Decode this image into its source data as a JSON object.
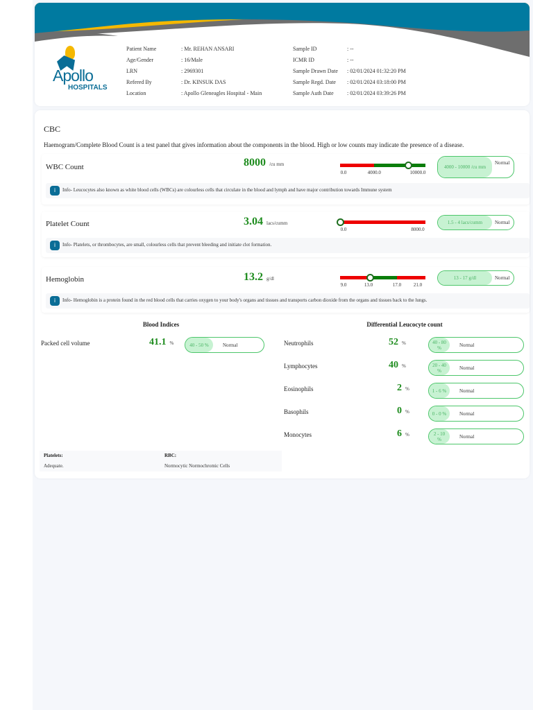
{
  "header": {
    "logo": {
      "line1": "Apollo",
      "line2": "HOSPITALS"
    },
    "left": [
      {
        "label": "Patient Name",
        "value": ": Mr. REHAN ANSARI"
      },
      {
        "label": "Age/Gender",
        "value": ": 16/Male"
      },
      {
        "label": "LRN",
        "value": ": 2969301"
      },
      {
        "label": "Refered By",
        "value": ": Dr. KINSUK DAS"
      },
      {
        "label": "Location",
        "value": ": Apollo Gleneagles Hospital - Main"
      }
    ],
    "right": [
      {
        "label": "Sample ID",
        "value": ": --"
      },
      {
        "label": "ICMR ID",
        "value": ": --"
      },
      {
        "label": "Sample Drawn Date",
        "value": ": 02/01/2024 01:32:20 PM"
      },
      {
        "label": "Sample Regd. Date",
        "value": ": 02/01/2024 03:18:00 PM"
      },
      {
        "label": "Sample Auth Date",
        "value": ": 02/01/2024 03:39:26 PM"
      }
    ]
  },
  "colors": {
    "teal": "#007aa0",
    "yellow": "#f5b800",
    "gray": "#6e6e6e",
    "green": "#1e8c1e",
    "red": "#ee0000",
    "bar_green": "#0a7d0a"
  },
  "cbc": {
    "title": "CBC",
    "description": "Haemogram/Complete Blood Count is a test panel that gives information about the components in the blood. High or low counts may indicate the presence of a disease.",
    "tests": [
      {
        "name": "WBC Count",
        "value": "8000",
        "unit": "/cu mm",
        "range": "4000 - 10000 /cu mm",
        "status": "Normal",
        "scale": {
          "min": 0,
          "max": 10000,
          "value": 8000,
          "ticks": [
            {
              "v": 0,
              "label": "0.0"
            },
            {
              "v": 4000,
              "label": "4000.0"
            },
            {
              "v": 10000,
              "label": "10000.0"
            }
          ],
          "segments": [
            {
              "from": 0,
              "to": 4000,
              "color": "red"
            },
            {
              "from": 4000,
              "to": 10000,
              "color": "green"
            }
          ]
        },
        "info": "Info- Leucocytes also known as white blood cells (WBCs) are colourless cells that circulate in the blood and lymph and have major contribution towards Immune system"
      },
      {
        "name": "Platelet Count",
        "value": "3.04",
        "unit": "lacs/cumm",
        "range": "1.5 - 4 lacs/cumm",
        "status": "Normal",
        "scale": {
          "min": 0,
          "max": 8000,
          "value": 3.04,
          "ticks": [
            {
              "v": 0,
              "label": "0.0"
            },
            {
              "v": 8000,
              "label": "8000.0"
            }
          ],
          "segments": [
            {
              "from": 0,
              "to": 8000,
              "color": "red"
            }
          ]
        },
        "info": "Info- Platelets, or thrombocytes, are small, colourless cells that prevent bleeding and initiate clot formation."
      },
      {
        "name": "Hemoglobin",
        "value": "13.2",
        "unit": "g/dl",
        "range": "13 - 17 g/dl",
        "status": "Normal",
        "scale": {
          "min": 9,
          "max": 21,
          "value": 13.2,
          "ticks": [
            {
              "v": 9,
              "label": "9.0"
            },
            {
              "v": 13,
              "label": "13.0"
            },
            {
              "v": 17,
              "label": "17.0"
            },
            {
              "v": 21,
              "label": "21.0"
            }
          ],
          "segments": [
            {
              "from": 9,
              "to": 13,
              "color": "red"
            },
            {
              "from": 13,
              "to": 17,
              "color": "green"
            },
            {
              "from": 17,
              "to": 21,
              "color": "red"
            }
          ]
        },
        "info": "Info- Hemoglobin is a protein found in the red blood cells that carries oxygen to your body's organs and tissues and transports carbon dioxide from the organs and tissues back to the lungs."
      }
    ]
  },
  "blood_indices": {
    "title": "Blood Indices",
    "items": [
      {
        "name": "Packed cell volume",
        "value": "41.1",
        "unit": "%",
        "range": "40 - 50 %",
        "status": "Normal"
      }
    ]
  },
  "dlc": {
    "title": "Differential Leucocyte count",
    "items": [
      {
        "name": "Neutrophils",
        "value": "52",
        "unit": "%",
        "range": "40 - 80 %",
        "status": "Normal"
      },
      {
        "name": "Lymphocytes",
        "value": "40",
        "unit": "%",
        "range": "20 - 40 %",
        "status": "Normal"
      },
      {
        "name": "Eosinophils",
        "value": "2",
        "unit": "%",
        "range": "1 - 6 %",
        "status": "Normal"
      },
      {
        "name": "Basophils",
        "value": "0",
        "unit": "%",
        "range": "0 - 0 %",
        "status": "Normal"
      },
      {
        "name": "Monocytes",
        "value": "6",
        "unit": "%",
        "range": "2 - 10 %",
        "status": "Normal"
      }
    ]
  },
  "notes": [
    {
      "label": "Platelets:",
      "value": "Adequate."
    },
    {
      "label": "RBC:",
      "value": "Normocytic Normochromic Cells"
    }
  ]
}
